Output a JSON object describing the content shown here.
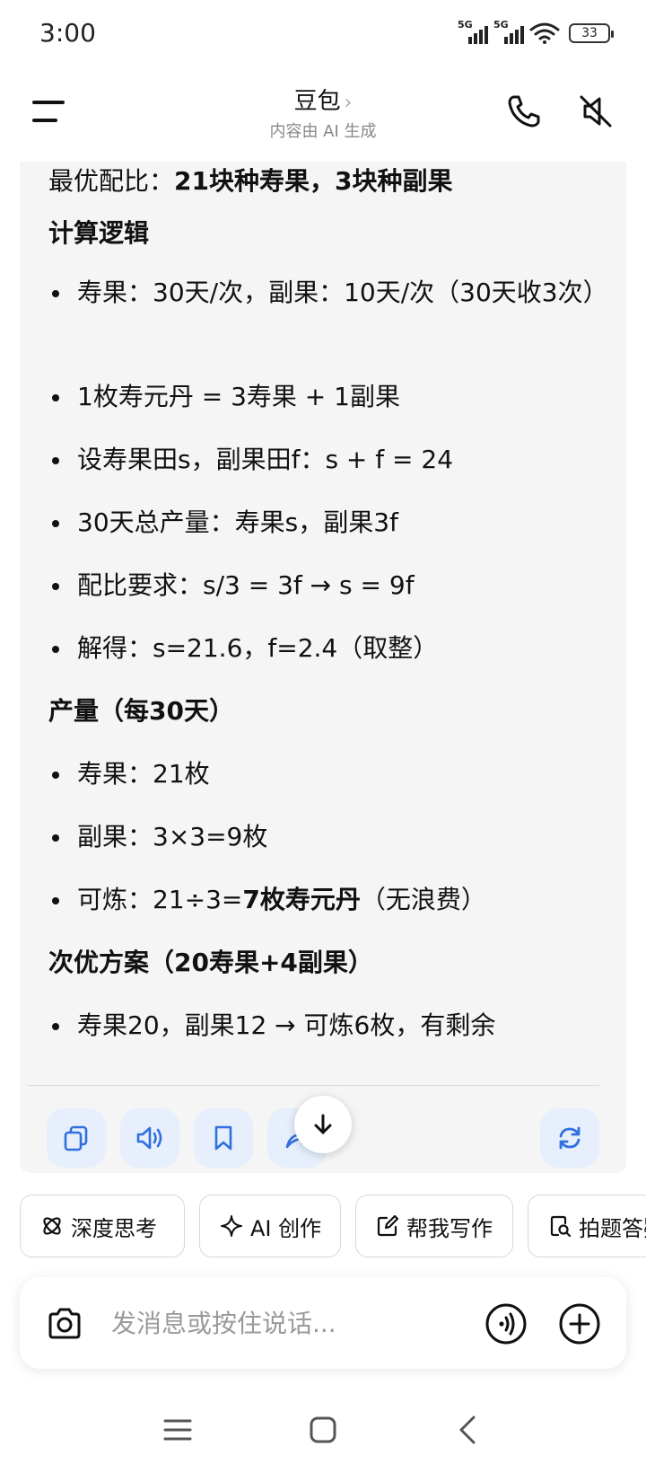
{
  "status_bar": {
    "time": "3:00",
    "signal1_label": "5G",
    "signal2_label": "5G",
    "battery": "33"
  },
  "header": {
    "title": "豆包",
    "title_chevron": "›",
    "subtitle": "内容由 AI 生成"
  },
  "message": {
    "line_optimal_prefix": "最优配比：",
    "line_optimal_bold": "21块种寿果，3块种副果",
    "heading_logic": "计算逻辑",
    "logic_1": "寿果：30天/次，副果：10天/次（30天收3次）",
    "logic_2": "1枚寿元丹 = 3寿果 + 1副果",
    "logic_3": "设寿果田s，副果田f：s + f = 24",
    "logic_4": "30天总产量：寿果s，副果3f",
    "logic_5": "配比要求：s/3 = 3f → s = 9f",
    "logic_6": "解得：s=21.6，f=2.4（取整）",
    "heading_output": "产量（每30天）",
    "output_1": "寿果：21枚",
    "output_2": "副果：3×3=9枚",
    "output_3_prefix": "可炼：21÷3=",
    "output_3_bold": "7枚寿元丹",
    "output_3_suffix": "（无浪费）",
    "heading_alt": "次优方案（20寿果+4副果）",
    "alt_1": "寿果20，副果12 → 可炼6枚，有剩余"
  },
  "actions": [
    "copy-icon",
    "speaker-icon",
    "bookmark-icon",
    "share-icon",
    "refresh-icon"
  ],
  "chips": [
    {
      "label": "深度思考",
      "icon": "atom-icon"
    },
    {
      "label": "AI 创作",
      "icon": "sparkle-icon"
    },
    {
      "label": "帮我写作",
      "icon": "edit-icon"
    },
    {
      "label": "拍题答疑",
      "icon": "scan-doc-icon"
    }
  ],
  "input": {
    "placeholder": "发消息或按住说话..."
  },
  "colors": {
    "accent": "#2f6fe0",
    "card_bg": "#f5f5f6",
    "action_bg": "#e6effb"
  }
}
